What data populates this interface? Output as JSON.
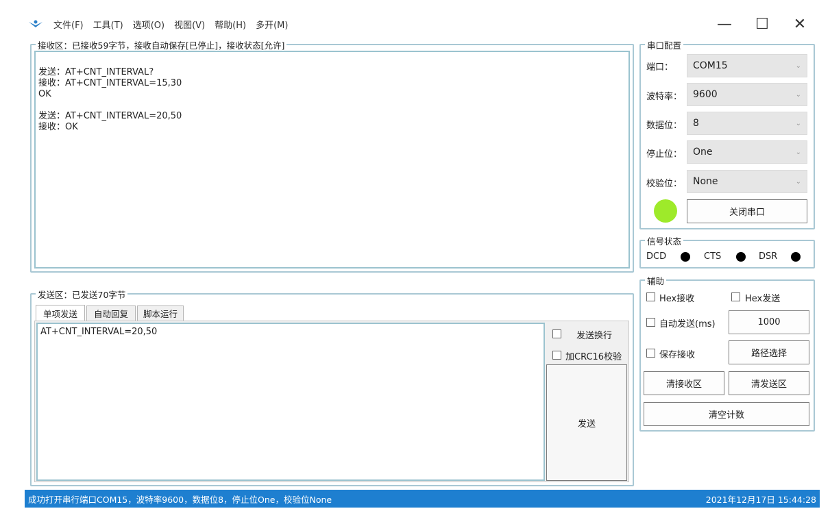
{
  "menu": [
    "文件(F)",
    "工具(T)",
    "选项(O)",
    "视图(V)",
    "帮助(H)",
    "多开(M)"
  ],
  "window_controls": {
    "minimize": "—",
    "maximize": "☐",
    "close": "✕"
  },
  "receive": {
    "title": "接收区：已接收59字节，接收自动保存[已停止]，接收状态[允许]",
    "content": "发送：AT+CNT_INTERVAL?\n接收：AT+CNT_INTERVAL=15,30\nOK\n\n发送：AT+CNT_INTERVAL=20,50\n接收：OK"
  },
  "send": {
    "title": "发送区：已发送70字节",
    "tabs": [
      "单项发送",
      "自动回复",
      "脚本运行"
    ],
    "content": "AT+CNT_INTERVAL=20,50",
    "newline_label": "发送换行",
    "crc_label": "加CRC16校验",
    "send_button": "发送"
  },
  "serial": {
    "title": "串口配置",
    "port_label": "端口：",
    "port_value": "COM15",
    "baud_label": "波特率：",
    "baud_value": "9600",
    "databits_label": "数据位：",
    "databits_value": "8",
    "stopbits_label": "停止位：",
    "stopbits_value": "One",
    "parity_label": "校验位：",
    "parity_value": "None",
    "close_button": "关闭串口",
    "indicator_color": "#9eea2a"
  },
  "signal": {
    "title": "信号状态",
    "dcd": "DCD",
    "cts": "CTS",
    "dsr": "DSR"
  },
  "aux": {
    "title": "辅助",
    "hex_receive": "Hex接收",
    "hex_send": "Hex发送",
    "auto_send": "自动发送(ms)",
    "auto_send_value": "1000",
    "save_receive": "保存接收",
    "path_button": "路径选择",
    "clear_receive": "清接收区",
    "clear_send": "清发送区",
    "clear_count": "清空计数"
  },
  "status": {
    "left": "成功打开串行端口COM15，波特率9600，数据位8，停止位One，校验位None",
    "right": "2021年12月17日 15:44:28"
  }
}
